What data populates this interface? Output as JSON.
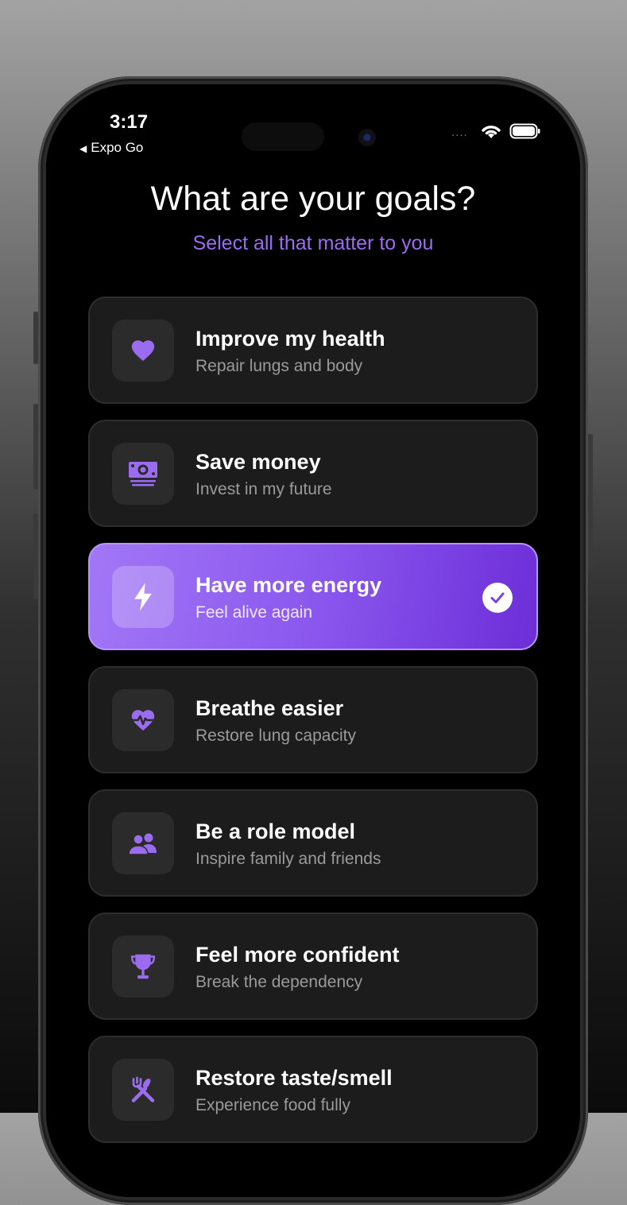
{
  "status_bar": {
    "time": "3:17",
    "back_app": "Expo Go",
    "signal_dots": "....",
    "back_arrow": "◀"
  },
  "header": {
    "title": "What are your goals?",
    "subtitle": "Select all that matter to you"
  },
  "theme": {
    "accent": "#9b6cf0",
    "card_background": "#1c1c1c",
    "selected_gradient": [
      "#a277f6",
      "#6c2ed8"
    ]
  },
  "goals": [
    {
      "title": "Improve my health",
      "description": "Repair lungs and body",
      "icon": "heart-icon",
      "selected": false
    },
    {
      "title": "Save money",
      "description": "Invest in my future",
      "icon": "money-icon",
      "selected": false
    },
    {
      "title": "Have more energy",
      "description": "Feel alive again",
      "icon": "lightning-icon",
      "selected": true
    },
    {
      "title": "Breathe easier",
      "description": "Restore lung capacity",
      "icon": "heart-pulse-icon",
      "selected": false
    },
    {
      "title": "Be a role model",
      "description": "Inspire family and friends",
      "icon": "people-icon",
      "selected": false
    },
    {
      "title": "Feel more confident",
      "description": "Break the dependency",
      "icon": "trophy-icon",
      "selected": false
    },
    {
      "title": "Restore taste/smell",
      "description": "Experience food fully",
      "icon": "utensils-icon",
      "selected": false
    }
  ]
}
